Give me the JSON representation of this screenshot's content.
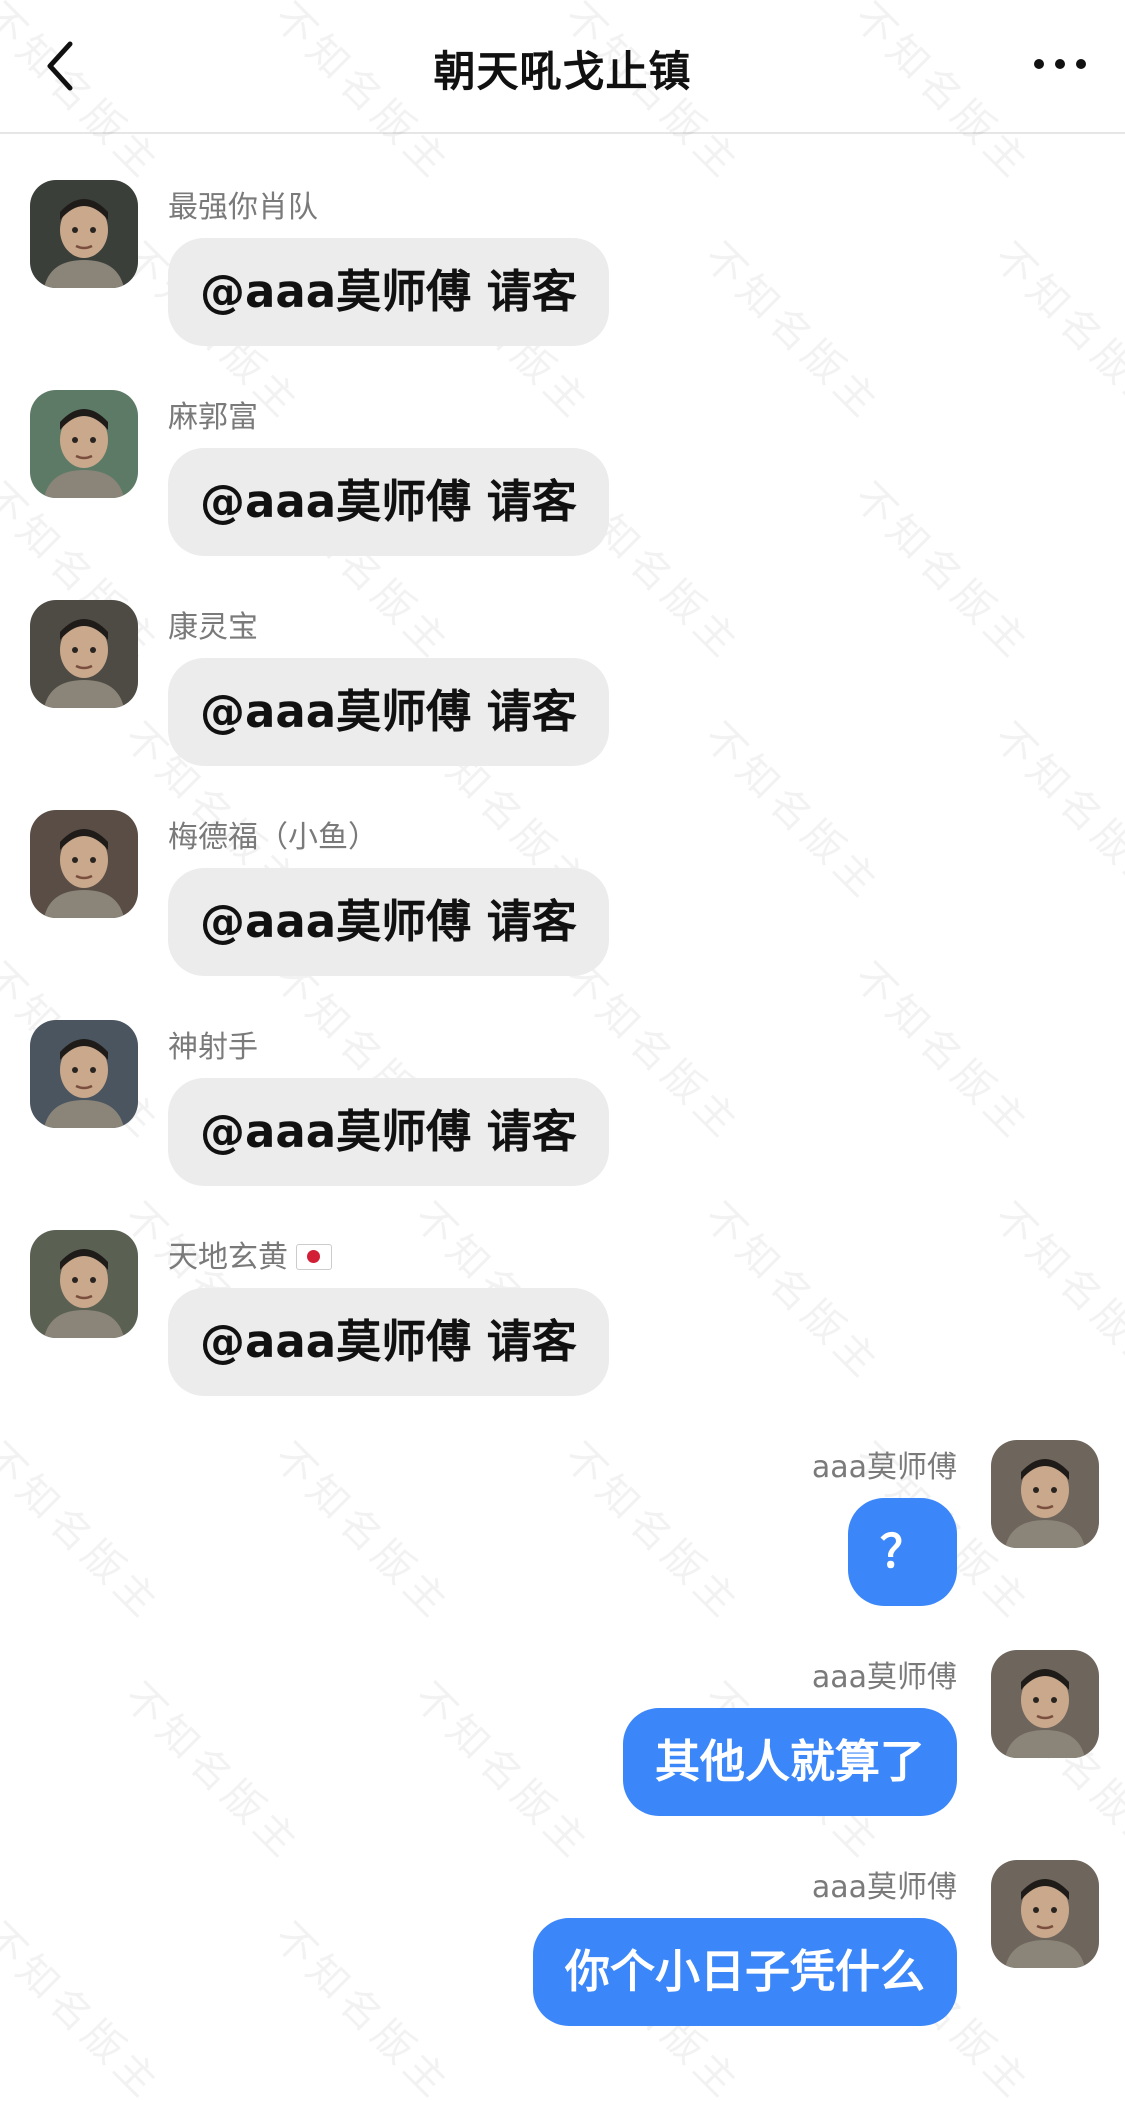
{
  "header": {
    "title": "朝天吼戈止镇",
    "back_icon": "chevron-left-icon",
    "more_icon": "more-horizontal-icon"
  },
  "watermark": "不知名版主",
  "messages_left": [
    {
      "name": "最强你肖队",
      "text": "@aaa莫师傅 请客",
      "avatar_color": "#3a3f3a"
    },
    {
      "name": "麻郭富",
      "text": "@aaa莫师傅 请客",
      "avatar_color": "#5d7a66"
    },
    {
      "name": "康灵宝",
      "text": "@aaa莫师傅 请客",
      "avatar_color": "#4e4a44"
    },
    {
      "name": "梅德福（小鱼）",
      "text": "@aaa莫师傅 请客",
      "avatar_color": "#5a4d45"
    },
    {
      "name": "神射手",
      "text": "@aaa莫师傅 请客",
      "avatar_color": "#4a5560"
    },
    {
      "name": "天地玄黄",
      "flag": "japan-flag-icon",
      "text": "@aaa莫师傅 请客",
      "avatar_color": "#5b6152"
    }
  ],
  "messages_right": [
    {
      "name": "aaa莫师傅",
      "text": "？",
      "avatar_color": "#6e655c"
    },
    {
      "name": "aaa莫师傅",
      "text": "其他人就算了",
      "avatar_color": "#6e655c"
    },
    {
      "name": "aaa莫师傅",
      "text": "你个小日子凭什么",
      "avatar_color": "#6e655c"
    }
  ],
  "colors": {
    "bubble_left": "#ececec",
    "bubble_right": "#3b86f8",
    "name_text": "#7a7a7a"
  }
}
